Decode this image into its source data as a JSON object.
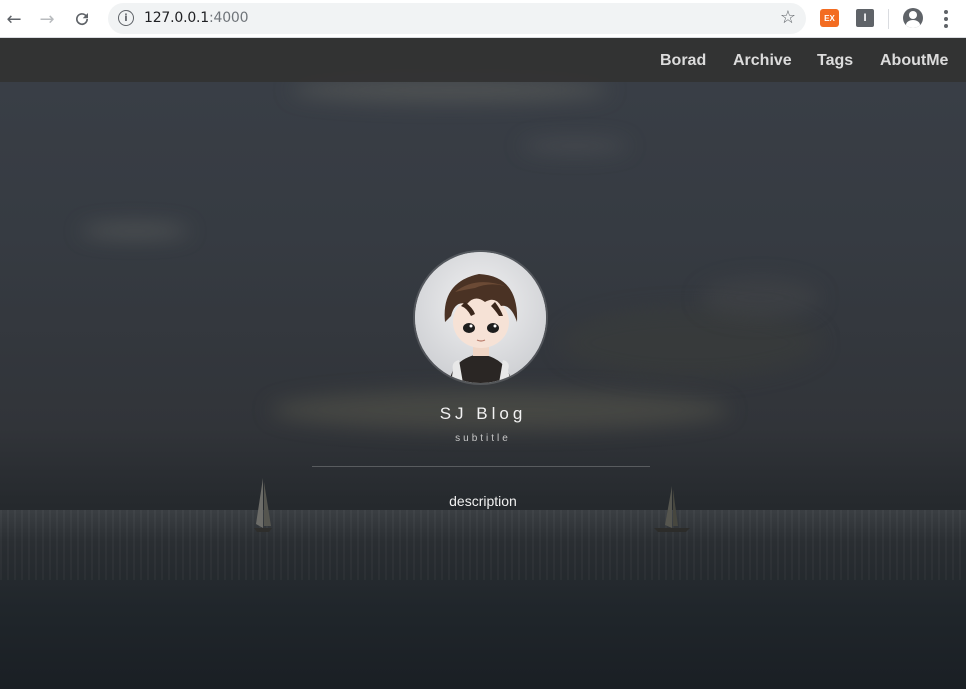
{
  "browser": {
    "url_host": "127.0.0.1",
    "url_port": ":4000"
  },
  "site": {
    "nav": [
      "Borad",
      "Archive",
      "Tags",
      "AboutMe"
    ],
    "title": "SJ Blog",
    "subtitle": "subtitle",
    "description": "description"
  },
  "extensions": {
    "ex_label": "EX",
    "i_label": "I"
  },
  "colors": {
    "nav_bg": "#323232",
    "ex_extension": "#f36c21"
  },
  "icons": [
    "back-arrow-icon",
    "forward-arrow-icon",
    "reload-icon",
    "info-icon",
    "bookmark-star-icon",
    "profile-icon",
    "menu-kebab-icon"
  ]
}
